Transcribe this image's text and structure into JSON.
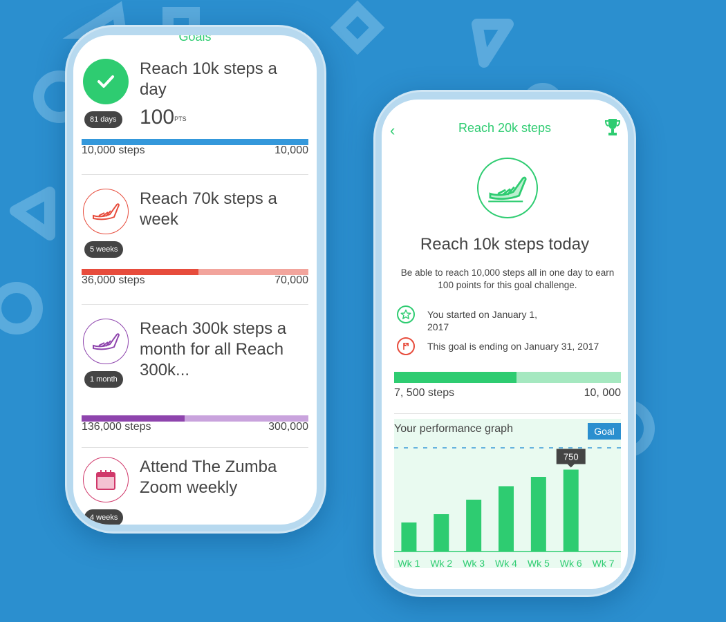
{
  "left_screen": {
    "header": "Goals",
    "goals": [
      {
        "icon": "checkmark-icon",
        "title": "Reach 10k steps a day",
        "duration": "81 days",
        "points": "100",
        "points_unit": "PTS",
        "progress_label": "10,000 steps",
        "target_label": "10,000",
        "progress_fraction": 1.0,
        "color": "#3498db",
        "rest_color": "#3498db"
      },
      {
        "icon": "sneaker-icon",
        "title": "Reach 70k steps a week",
        "duration": "5 weeks",
        "progress_label": "36,000 steps",
        "target_label": "70,000",
        "progress_fraction": 0.5143,
        "color": "#e74c3c",
        "rest_color": "#f2a49c"
      },
      {
        "icon": "sneaker-icon",
        "title": "Reach 300k steps a month for all Reach 300k...",
        "duration": "1 month",
        "progress_label": "136,000 steps",
        "target_label": "300,000",
        "progress_fraction": 0.4533,
        "color": "#8e44ad",
        "rest_color": "#c9a3dd"
      },
      {
        "icon": "calendar-icon",
        "title": "Attend The Zumba Zoom weekly",
        "duration": "4 weeks",
        "color": "#d0386a"
      }
    ]
  },
  "right_screen": {
    "nav": {
      "back": "‹",
      "title": "Reach 20k steps",
      "trophy_icon": "trophy-icon"
    },
    "goal_title": "Reach 10k steps today",
    "description": "Be able to reach 10,000 steps all in one day to earn 100 points for this goal challenge.",
    "info": [
      {
        "icon": "star-icon",
        "text": "You started on January 1, 2017",
        "color": "#2ecc71"
      },
      {
        "icon": "flag-icon",
        "text": "This goal is ending on January 31, 2017",
        "color": "#e74c3c"
      }
    ],
    "progress": {
      "current_label": "7, 500 steps",
      "target_label": "10, 000",
      "fraction": 0.54
    },
    "graph_title": "Your performance graph",
    "goal_badge": "Goal",
    "accent": "#2ecc71"
  },
  "chart_data": {
    "type": "bar",
    "categories": [
      "Wk 1",
      "Wk 2",
      "Wk 3",
      "Wk 4",
      "Wk 5",
      "Wk 6",
      "Wk 7"
    ],
    "values": [
      280,
      360,
      500,
      630,
      720,
      790,
      null
    ],
    "goal_line": 1000,
    "ylim": [
      0,
      1000
    ],
    "tooltip": {
      "category": "Wk 6",
      "label": "750"
    },
    "title": "Your performance graph",
    "xlabel": "",
    "ylabel": "",
    "color": "#2ecc71",
    "grid": false
  }
}
